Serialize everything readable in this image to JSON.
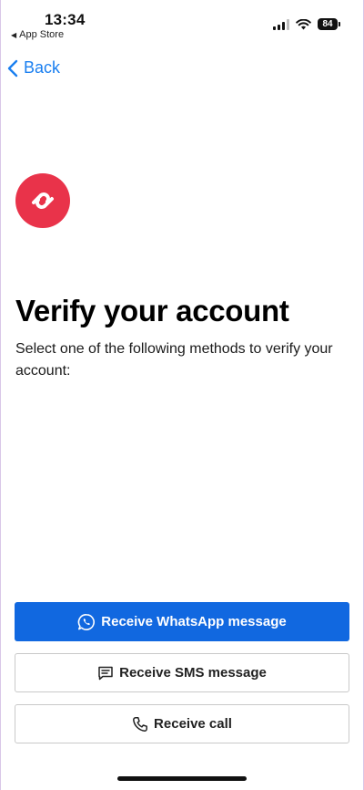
{
  "status_bar": {
    "time": "13:34",
    "back_app_label": "App Store",
    "battery_level": "84"
  },
  "nav": {
    "back_label": "Back"
  },
  "content": {
    "title": "Verify your account",
    "subtitle": "Select one of the following methods to verify your account:"
  },
  "actions": {
    "whatsapp_label": "Receive WhatsApp message",
    "sms_label": "Receive SMS message",
    "call_label": "Receive call"
  },
  "colors": {
    "primary": "#1168e0",
    "logo": "#e9334a",
    "link": "#1a7ff0"
  },
  "icons": {
    "logo": "authy-logo-icon",
    "whatsapp": "whatsapp-icon",
    "sms": "message-icon",
    "call": "phone-icon"
  }
}
